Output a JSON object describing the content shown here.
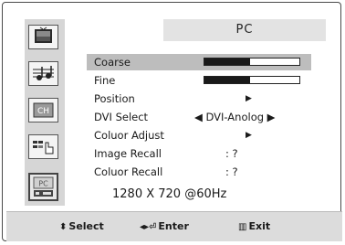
{
  "title": "PC",
  "menu": {
    "items": [
      {
        "label": "Coarse",
        "control": "bar",
        "level": 0.48,
        "selected": true
      },
      {
        "label": "Fine",
        "control": "bar",
        "level": 0.48,
        "selected": false
      },
      {
        "label": "Position",
        "control": "arrow",
        "selected": false
      },
      {
        "label": "DVI Select",
        "control": "value",
        "value": "◀ DVI-Anolog ▶",
        "selected": false
      },
      {
        "label": "Coluor Adjust",
        "control": "arrow",
        "selected": false
      },
      {
        "label": "Image Recall",
        "control": "colon",
        "value": ": ?",
        "selected": false
      },
      {
        "label": "Coluor Recall",
        "control": "colon",
        "value": ": ?",
        "selected": false
      }
    ]
  },
  "resolution": "1280 X 720   @60Hz",
  "sidebar": {
    "icons": [
      "picture-icon",
      "sound-icon",
      "channel-icon",
      "setup-icon",
      "pc-icon"
    ],
    "ch_text": "CH",
    "pc_text": "PC",
    "active": "pc-icon"
  },
  "bottom_nav": {
    "select_label": "Select",
    "enter_label": "Enter",
    "exit_label": "Exit"
  },
  "colors": {
    "selected_row": "#bdbdbd",
    "bar_fill": "#1a1a1a",
    "sidebar": "#d6d6d6"
  }
}
